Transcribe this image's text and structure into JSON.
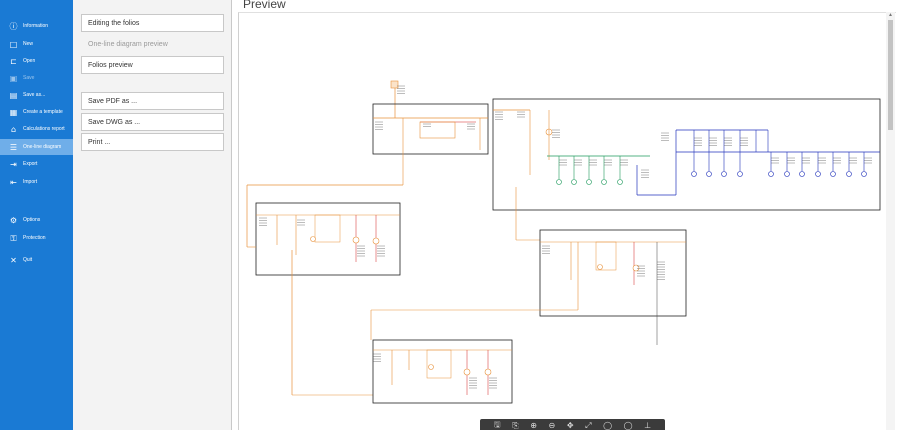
{
  "nav": {
    "items": [
      {
        "label": "Information",
        "icon": "info-icon",
        "glyph": "ⓘ",
        "state": "normal"
      },
      {
        "label": "New",
        "icon": "new-file-icon",
        "glyph": "□",
        "state": "normal"
      },
      {
        "label": "Open",
        "icon": "open-folder-icon",
        "glyph": "⊏",
        "state": "normal"
      },
      {
        "label": "Save",
        "icon": "save-icon",
        "glyph": "▣",
        "state": "disabled"
      },
      {
        "label": "Save as...",
        "icon": "save-as-icon",
        "glyph": "▤",
        "state": "normal"
      },
      {
        "label": "Create a template",
        "icon": "template-icon",
        "glyph": "▦",
        "state": "normal"
      },
      {
        "label": "Calculations report",
        "icon": "report-icon",
        "glyph": "⌂",
        "state": "normal"
      },
      {
        "label": "One-line diagram",
        "icon": "diagram-icon",
        "glyph": "☰",
        "state": "active"
      },
      {
        "label": "Export",
        "icon": "export-icon",
        "glyph": "⇥",
        "state": "normal"
      },
      {
        "label": "Import",
        "icon": "import-icon",
        "glyph": "⇤",
        "state": "normal"
      },
      {
        "label": "Options",
        "icon": "gear-icon",
        "glyph": "⚙",
        "state": "normal"
      },
      {
        "label": "Protection",
        "icon": "key-icon",
        "glyph": "⚿",
        "state": "normal"
      },
      {
        "label": "Quit",
        "icon": "close-icon",
        "glyph": "✕",
        "state": "normal"
      }
    ]
  },
  "mid": {
    "editing_folios": "Editing the folios",
    "one_line_preview": "One-line diagram preview",
    "folios_preview": "Folios preview",
    "save_pdf": "Save PDF as ...",
    "save_dwg": "Save DWG as ...",
    "print": "Print ..."
  },
  "preview": {
    "title": "Preview"
  },
  "toolbar": {
    "icons": [
      "save-icon",
      "copy-icon",
      "zoom-icon",
      "zoom-out-icon",
      "pan-icon",
      "fit-icon",
      "zoom-in-icon",
      "zoom-reset-icon",
      "pin-icon"
    ]
  },
  "colors": {
    "nav_bg": "#1a7ad4",
    "nav_active": "#6faee9",
    "wire_orange": "#e8913a",
    "wire_red": "#d42020",
    "wire_blue": "#2233bb",
    "wire_green": "#1e9a5c",
    "box_border": "#222222"
  }
}
